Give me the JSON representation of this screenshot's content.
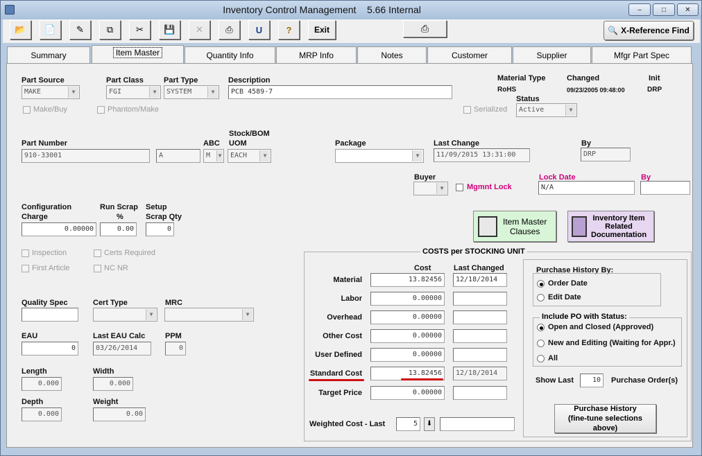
{
  "window": {
    "title": "Inventory Control Management",
    "version": "5.66 Internal",
    "minimize": "–",
    "maximize": "□",
    "close": "✕"
  },
  "toolbar": {
    "exit_label": "Exit",
    "xref_label": "X-Reference Find",
    "print_glyph": "⎙",
    "icons": [
      "open-icon",
      "new-icon",
      "edit-icon",
      "copy-icon",
      "cut-icon",
      "save-icon",
      "delete-icon",
      "print-icon",
      "undo-icon",
      "help-icon"
    ]
  },
  "tabs": [
    "Summary",
    "Item Master",
    "Quantity Info",
    "MRP Info",
    "Notes",
    "Customer",
    "Supplier",
    "Mfgr Part Spec"
  ],
  "part": {
    "source_label": "Part Source",
    "source": "MAKE",
    "class_label": "Part Class",
    "class": "FGI",
    "type_label": "Part Type",
    "type": "SYSTEM",
    "description_label": "Description",
    "description": "PCB 4589-7",
    "make_buy_label": "Make/Buy",
    "phantom_label": "Phantom/Make",
    "material_type_label": "Material Type",
    "material_type": "RoHS",
    "changed_label": "Changed",
    "changed": "09/23/2005 09:48:00",
    "init_label": "Init",
    "init": "DRP",
    "serialized_label": "Serialized",
    "status_label": "Status",
    "status": "Active",
    "number_label": "Part Number",
    "number": "910-33001",
    "rev": "A",
    "abc_label": "ABC",
    "abc": "M",
    "uom_label1": "Stock/BOM",
    "uom_label2": "UOM",
    "uom": "EACH",
    "package_label": "Package",
    "package": "",
    "last_change_label": "Last Change",
    "last_change": "11/09/2015 13:31:00",
    "by_label": "By",
    "by": "DRP",
    "buyer_label": "Buyer",
    "buyer": "",
    "mgmnt_lock_label": "Mgmnt Lock",
    "lock_date_label": "Lock Date",
    "lock_date": "N/A",
    "lock_by_label": "By",
    "lock_by": ""
  },
  "config": {
    "charge_label1": "Configuration",
    "charge_label2": "Charge",
    "charge": "0.00000",
    "run_scrap_label1": "Run Scrap",
    "run_scrap_label2": "%",
    "run_scrap": "0.00",
    "setup_label1": "Setup",
    "setup_label2": "Scrap Qty",
    "setup": "0"
  },
  "buttons": {
    "clauses_line1": "Item Master",
    "clauses_line2": "Clauses",
    "docs_line1": "Inventory Item",
    "docs_line2": "Related",
    "docs_line3": "Documentation"
  },
  "checks": {
    "inspection": "Inspection",
    "certs": "Certs Required",
    "first_article": "First Article",
    "ncnr": "NC NR"
  },
  "quality": {
    "spec_label": "Quality Spec",
    "spec": "",
    "cert_type_label": "Cert Type",
    "cert_type": "",
    "mrc_label": "MRC",
    "mrc": "",
    "eau_label": "EAU",
    "eau": "0",
    "last_eau_label": "Last EAU Calc",
    "last_eau": "03/26/2014",
    "ppm_label": "PPM",
    "ppm": "0",
    "length_label": "Length",
    "length": "0.000",
    "width_label": "Width",
    "width": "0.000",
    "depth_label": "Depth",
    "depth": "0.000",
    "weight_label": "Weight",
    "weight": "0.00"
  },
  "costs": {
    "title": "COSTS per STOCKING UNIT",
    "cost_header": "Cost",
    "last_changed_header": "Last Changed",
    "rows": [
      {
        "label": "Material",
        "cost": "13.82456",
        "date": "12/18/2014"
      },
      {
        "label": "Labor",
        "cost": "0.00000",
        "date": ""
      },
      {
        "label": "Overhead",
        "cost": "0.00000",
        "date": ""
      },
      {
        "label": "Other Cost",
        "cost": "0.00000",
        "date": ""
      },
      {
        "label": "User Defined",
        "cost": "0.00000",
        "date": ""
      },
      {
        "label": "Standard Cost",
        "cost": "13.82456",
        "date": "12/18/2014"
      },
      {
        "label": "Target Price",
        "cost": "0.00000",
        "date": ""
      }
    ],
    "weighted_label": "Weighted Cost - Last",
    "weighted_n": "5",
    "weighted_value": "",
    "spin_glyph": "⬇"
  },
  "purchase": {
    "history_by_title": "Purchase History By:",
    "order_date": "Order Date",
    "edit_date": "Edit Date",
    "po_status_title": "Include PO with Status:",
    "open_closed": "Open and Closed (Approved)",
    "new_editing": "New and Editing (Waiting for Appr.)",
    "all": "All",
    "show_last_label": "Show Last",
    "show_last": "10",
    "orders_label": "Purchase Order(s)",
    "history_btn1": "Purchase History",
    "history_btn2": "(fine-tune selections",
    "history_btn3": "above)"
  }
}
